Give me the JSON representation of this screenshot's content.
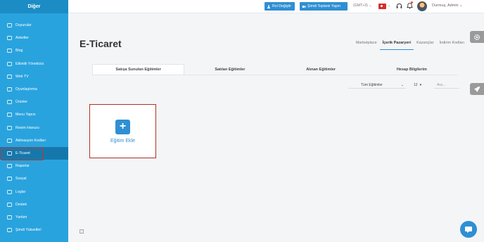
{
  "sidebar": {
    "header": "Diğer",
    "items": [
      {
        "label": "Duyurular",
        "icon": "clipboard-icon"
      },
      {
        "label": "Anketler",
        "icon": "checklist-icon"
      },
      {
        "label": "Blog",
        "icon": "edit-icon"
      },
      {
        "label": "Etkinlik Yöneticisi",
        "icon": "grid-icon"
      },
      {
        "label": "Web TV",
        "icon": "monitor-icon"
      },
      {
        "label": "Oyunlaştırma",
        "icon": "gamepad-icon"
      },
      {
        "label": "Ürünler",
        "icon": "box-icon"
      },
      {
        "label": "Menu Yapısı",
        "icon": "menu-icon"
      },
      {
        "label": "Resim Havuzu",
        "icon": "image-icon"
      },
      {
        "label": "Aktivasyon Kodları",
        "icon": "code-icon"
      },
      {
        "label": "E-Ticaret",
        "icon": "edit-icon"
      },
      {
        "label": "Raporlar",
        "icon": "chart-icon"
      },
      {
        "label": "Sosyal",
        "icon": "social-icon"
      },
      {
        "label": "Loglar",
        "icon": "list-icon"
      },
      {
        "label": "Destek",
        "icon": "lifebuoy-icon"
      },
      {
        "label": "Yardım",
        "icon": "help-icon"
      },
      {
        "label": "Şimdi Yükseltin!",
        "icon": "upgrade-icon"
      }
    ],
    "active_index": 10
  },
  "topbar": {
    "role_button": "Rol Değiştir",
    "meeting_button": "Şimdi Toplantı Yapın",
    "timezone": "(GMT+3) ⌄",
    "flag_caret": "⌄",
    "user_name": "Durmuş, Admin ⌄"
  },
  "page": {
    "title": "E-Ticaret",
    "top_tabs": [
      "Marketplace",
      "İçerik Pazaryeri",
      "Kazançlar",
      "İndirim Kodları"
    ],
    "active_top_tab": 1,
    "sub_tabs": [
      "Satışa Sunulan Eğitimler",
      "Satılan Eğitimler",
      "Alınan Eğitimler",
      "Hesap Bilgilerim"
    ],
    "active_sub_tab": 0,
    "filter": {
      "selected": "Tüm Eğitimler",
      "caret": "⌄"
    },
    "page_size": {
      "selected": "12",
      "caret": "▾"
    },
    "search_placeholder": "Ara...",
    "add_card_label": "Eğitim Ekle"
  },
  "colors": {
    "sidebar": "#29a3de",
    "sidebar_active": "#1578ad",
    "accent": "#2f8fd3",
    "highlight_border": "#b03025"
  }
}
